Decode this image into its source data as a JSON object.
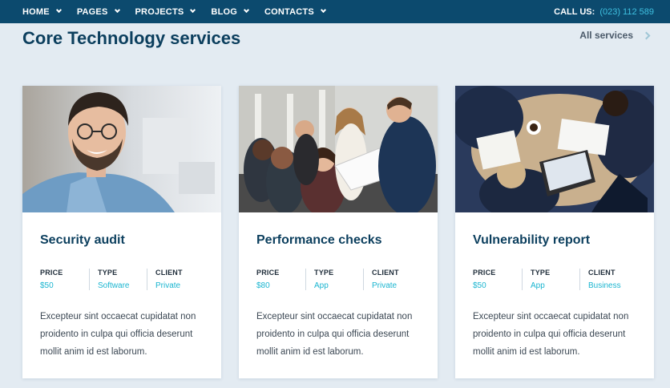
{
  "nav": {
    "items": [
      {
        "label": "HOME"
      },
      {
        "label": "PAGES"
      },
      {
        "label": "PROJECTS"
      },
      {
        "label": "BLOG"
      },
      {
        "label": "CONTACTS"
      }
    ],
    "call_label": "CALL US:",
    "phone": "(023) 112 589"
  },
  "section": {
    "title": "Core Technology services",
    "all_link": "All services"
  },
  "meta_labels": {
    "price": "PRICE",
    "type": "TYPE",
    "client": "CLIENT"
  },
  "cards": [
    {
      "title": "Security audit",
      "price": "$50",
      "type": "Software",
      "client": "Private",
      "text": "Excepteur sint occaecat cupidatat non proidento in culpa qui officia deserunt mollit anim id est laborum."
    },
    {
      "title": "Performance checks",
      "price": "$80",
      "type": "App",
      "client": "Private",
      "text": "Excepteur sint occaecat cupidatat non proidento in culpa qui officia deserunt mollit anim id est laborum."
    },
    {
      "title": "Vulnerability report",
      "price": "$50",
      "type": "App",
      "client": "Business",
      "text": "Excepteur sint occaecat cupidatat non proidento in culpa qui officia deserunt mollit anim id est laborum."
    }
  ],
  "colors": {
    "nav_bg": "#0c4a6e",
    "page_bg": "#e3ebf2",
    "title": "#0c3f5e",
    "accent": "#1ab5d0",
    "phone": "#3fc0e0"
  }
}
